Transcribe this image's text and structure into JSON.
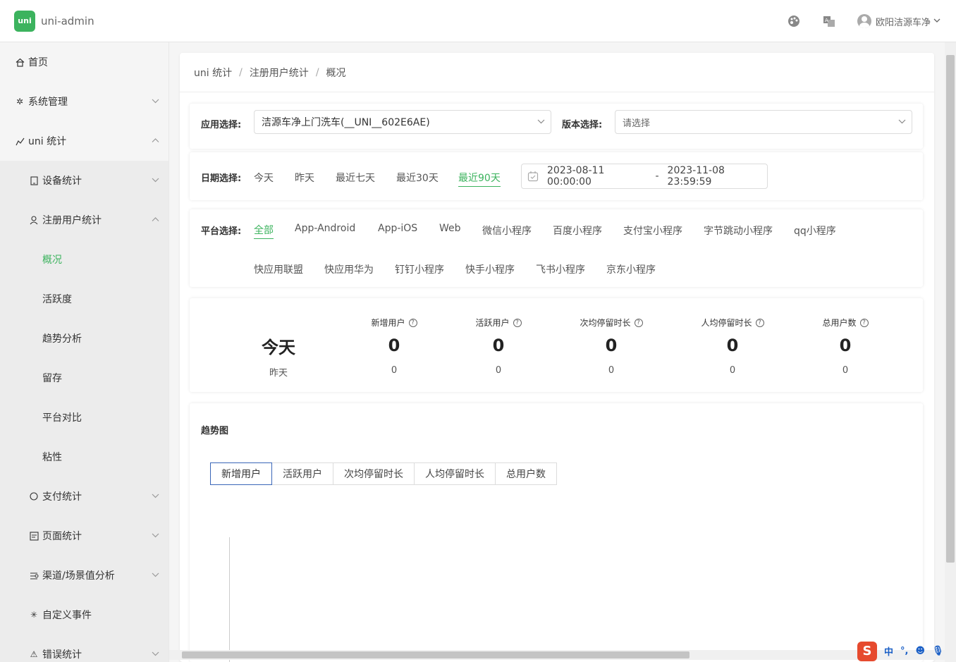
{
  "app": {
    "logo_text": "uni",
    "title": "uni-admin"
  },
  "header": {
    "user_name": "欧阳洁源车净"
  },
  "sidebar": {
    "items": [
      {
        "label": "首页",
        "icon": "home-icon"
      },
      {
        "label": "系统管理",
        "icon": "gear-icon"
      },
      {
        "label": "uni 统计",
        "icon": "chart-icon"
      }
    ],
    "uni_stat_children": [
      {
        "label": "设备统计",
        "icon": "device-icon"
      },
      {
        "label": "注册用户统计",
        "icon": "user-icon"
      }
    ],
    "register_children": [
      {
        "label": "概况"
      },
      {
        "label": "活跃度"
      },
      {
        "label": "趋势分析"
      },
      {
        "label": "留存"
      },
      {
        "label": "平台对比"
      },
      {
        "label": "粘性"
      }
    ],
    "more_children": [
      {
        "label": "支付统计",
        "icon": "circle-icon"
      },
      {
        "label": "页面统计",
        "icon": "page-icon"
      },
      {
        "label": "渠道/场景值分析",
        "icon": "channel-icon"
      },
      {
        "label": "自定义事件",
        "icon": "spark-icon"
      },
      {
        "label": "错误统计",
        "icon": "error-icon"
      }
    ]
  },
  "breadcrumb": [
    "uni 统计",
    "注册用户统计",
    "概况"
  ],
  "filters": {
    "app_label": "应用选择:",
    "app_value": "洁源车净上门洗车(__UNI__602E6AE)",
    "version_label": "版本选择:",
    "version_placeholder": "请选择",
    "date_label": "日期选择:",
    "date_options": [
      "今天",
      "昨天",
      "最近七天",
      "最近30天",
      "最近90天"
    ],
    "date_start": "2023-08-11 00:00:00",
    "date_sep": "-",
    "date_end": "2023-11-08 23:59:59",
    "platform_label": "平台选择:",
    "platforms_row1": [
      "全部",
      "App-Android",
      "App-iOS",
      "Web",
      "微信小程序",
      "百度小程序",
      "支付宝小程序",
      "字节跳动小程序",
      "qq小程序"
    ],
    "platforms_row2": [
      "快应用联盟",
      "快应用华为",
      "钉钉小程序",
      "快手小程序",
      "飞书小程序",
      "京东小程序"
    ]
  },
  "stats": {
    "today_label": "今天",
    "yesterday_label": "昨天",
    "columns": [
      {
        "title": "新增用户",
        "today": "0",
        "yesterday": "0"
      },
      {
        "title": "活跃用户",
        "today": "0",
        "yesterday": "0"
      },
      {
        "title": "次均停留时长",
        "today": "0",
        "yesterday": "0"
      },
      {
        "title": "人均停留时长",
        "today": "0",
        "yesterday": "0"
      },
      {
        "title": "总用户数",
        "today": "0",
        "yesterday": "0"
      }
    ]
  },
  "trend": {
    "title": "趋势图",
    "tabs": [
      "新增用户",
      "活跃用户",
      "次均停留时长",
      "人均停留时长",
      "总用户数"
    ]
  },
  "ime": {
    "logo": "S",
    "lang": "中"
  },
  "colors": {
    "accent": "#3cb35e",
    "tab_active_border": "#3a66b8"
  }
}
